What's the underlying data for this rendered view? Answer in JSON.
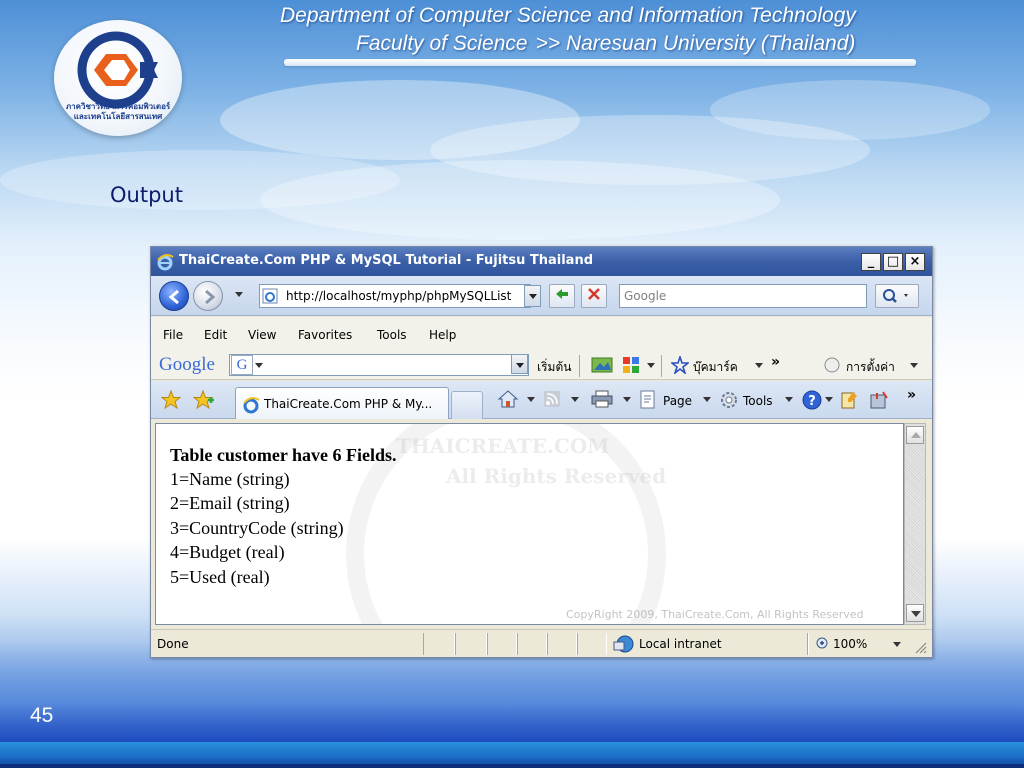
{
  "slide": {
    "header": {
      "line1": "Department of Computer Science and Information Technology",
      "line2_left": "Faculty of Science",
      "line2_right": ">> Naresuan University (Thailand)"
    },
    "logo": {
      "line1": "ภาควิชาวิทยาการคอมพิวเตอร์",
      "line2": "และเทคโนโลยีสารสนเทศ"
    },
    "heading": "Output",
    "page_number": "45"
  },
  "browser": {
    "title": "ThaiCreate.Com PHP & MySQL Tutorial - Fujitsu Thailand",
    "window_buttons": {
      "minimize": "_",
      "maximize": "□",
      "close": "×"
    },
    "address": "http://localhost/myphp/phpMySQLList",
    "search_placeholder": "Google",
    "menu": [
      "File",
      "Edit",
      "View",
      "Favorites",
      "Tools",
      "Help"
    ],
    "google_bar": {
      "logo": "Google",
      "g_button": "G",
      "start_label": "เริ่มต้น",
      "bookmarks_label": "บุ๊คมาร์ค",
      "more": "»",
      "settings_label": "การตั้งค่า"
    },
    "tab_title": "ThaiCreate.Com PHP & My...",
    "commands": {
      "page": "Page",
      "tools": "Tools",
      "more": "»"
    },
    "page": {
      "heading": "Table customer have 6 Fields.",
      "fields": [
        "1=Name (string)",
        "2=Email (string)",
        "3=CountryCode (string)",
        "4=Budget (real)",
        "5=Used (real)"
      ],
      "watermark_line1": "THAICREATE.COM",
      "watermark_line2": "All Rights Reserved",
      "copyright": "CopyRight 2009, ThaiCreate.Com, All Rights Reserved"
    },
    "status": {
      "text": "Done",
      "zone": "Local intranet",
      "zoom": "100%"
    }
  },
  "colors": {
    "title_bar": "#3b60a8",
    "heading_text": "#0b1d6b",
    "window_chrome": "#ece9d8"
  }
}
